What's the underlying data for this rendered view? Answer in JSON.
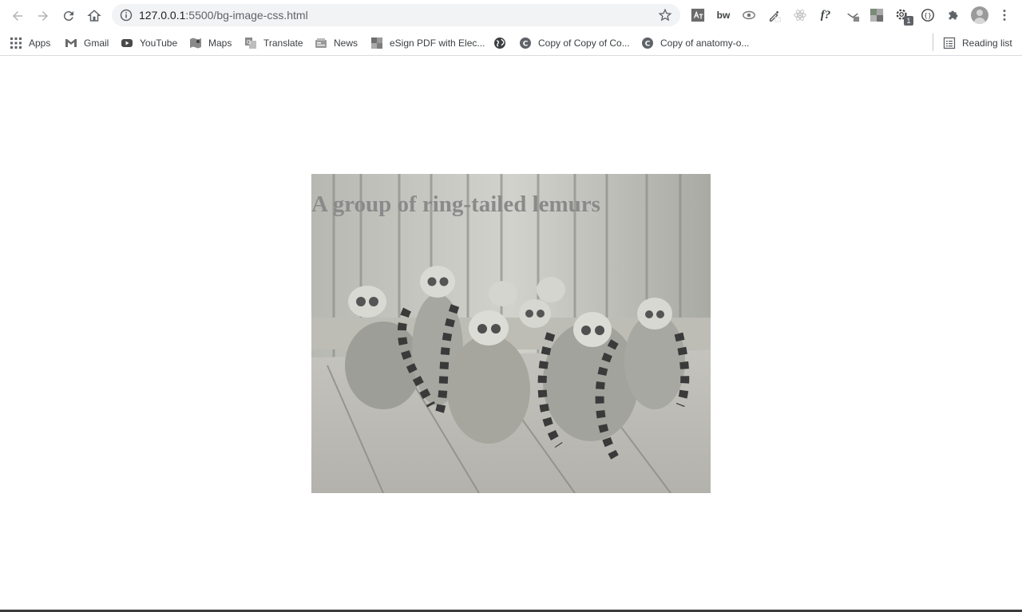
{
  "browser": {
    "url_host": "127.0.0.1",
    "url_path": ":5500/bg-image-css.html",
    "icons": {
      "back": "back-arrow-icon",
      "forward": "forward-arrow-icon",
      "reload": "reload-icon",
      "home": "home-icon",
      "site_info": "info-icon",
      "bookmark_star": "star-icon",
      "menu": "kebab-menu-icon"
    },
    "extensions": [
      "translate-extension-icon",
      "bw-extension-icon",
      "eye-extension-icon",
      "eyedropper-extension-icon",
      "react-extension-icon",
      "font-extension-icon",
      "download-extension-icon",
      "pattern-extension-icon",
      "gear-badge-extension-icon",
      "braces-extension-icon",
      "puzzle-icon",
      "avatar"
    ],
    "ext_labels": {
      "bw": "bw",
      "font": "f?",
      "badge": "1"
    }
  },
  "bookmarks": [
    {
      "label": "Apps",
      "icon": "apps-grid-icon"
    },
    {
      "label": "Gmail",
      "icon": "gmail-icon"
    },
    {
      "label": "YouTube",
      "icon": "youtube-icon"
    },
    {
      "label": "Maps",
      "icon": "maps-icon"
    },
    {
      "label": "Translate",
      "icon": "translate-icon"
    },
    {
      "label": "News",
      "icon": "news-icon"
    },
    {
      "label": "eSign PDF with Elec...",
      "icon": "esign-icon"
    },
    {
      "label": "",
      "icon": "globe-icon"
    },
    {
      "label": "Copy of Copy of Co...",
      "icon": "canva-icon"
    },
    {
      "label": "Copy of anatomy-o...",
      "icon": "canva-icon"
    }
  ],
  "reading_list": {
    "label": "Reading list",
    "icon": "reading-list-icon"
  },
  "page": {
    "heading": "A group of ring-tailed lemurs",
    "image_subject": "ring-tailed lemurs on wooden bench",
    "colors": {
      "heading": "#8a8a8a",
      "background": "#ffffff"
    }
  }
}
